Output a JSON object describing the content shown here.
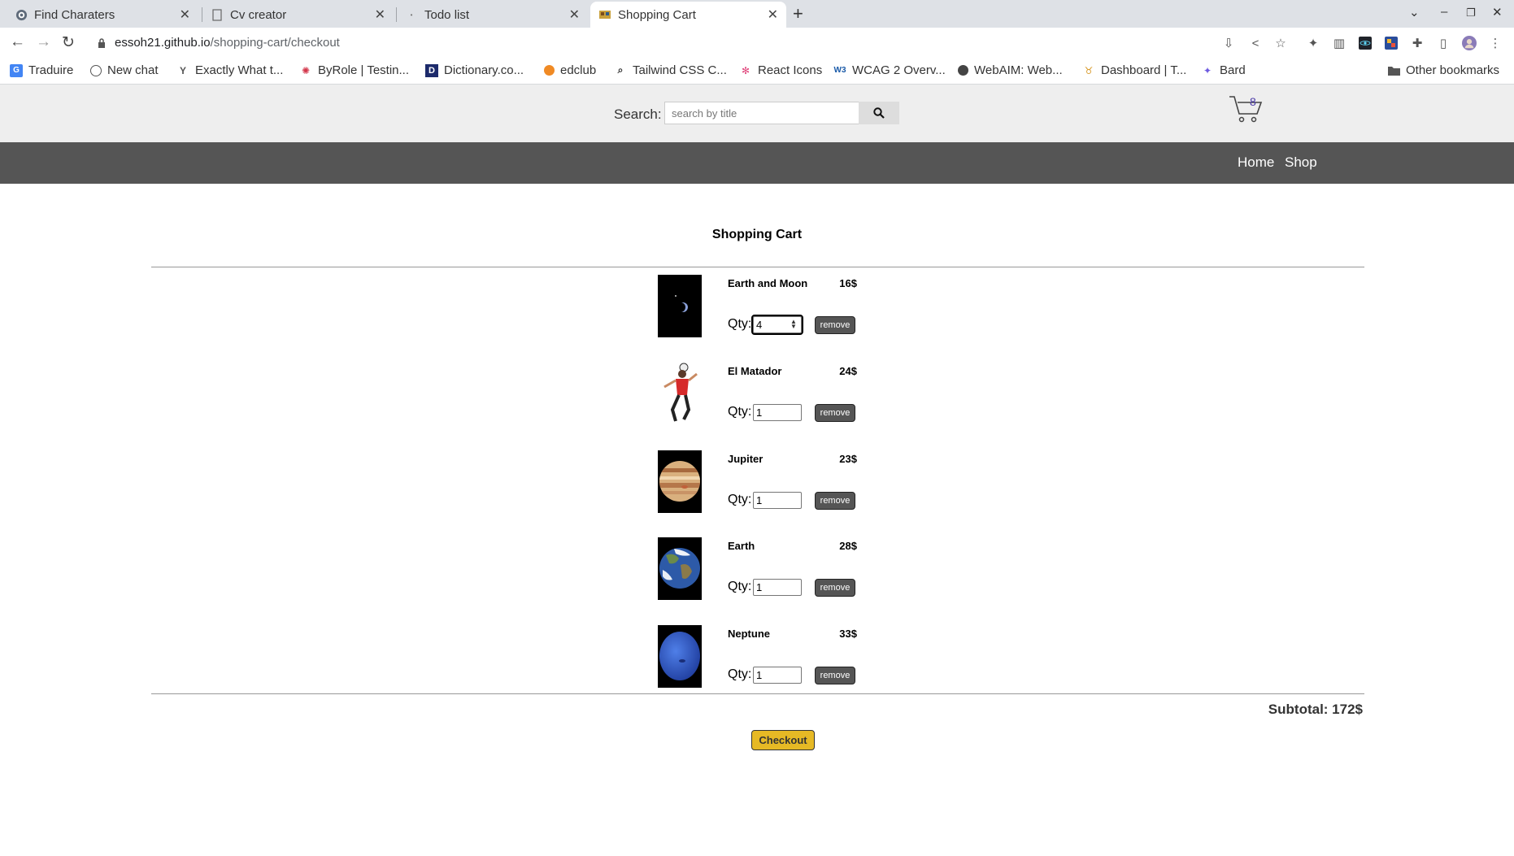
{
  "browser": {
    "tabs": [
      {
        "title": "Find Charaters",
        "icon": "globe-icon"
      },
      {
        "title": "Cv creator",
        "icon": "document-icon"
      },
      {
        "title": "Todo list",
        "icon": "dot-icon"
      },
      {
        "title": "Shopping Cart",
        "icon": "cart-favicon",
        "active": true
      }
    ],
    "url_host": "essoh21.github.io",
    "url_path": "/shopping-cart/checkout",
    "bookmarks": [
      {
        "label": "Traduire",
        "icon": "translate-icon"
      },
      {
        "label": "New chat",
        "icon": "chatgpt-icon"
      },
      {
        "label": "Exactly What t...",
        "icon": "y-icon"
      },
      {
        "label": "ByRole | Testin...",
        "icon": "octopus-icon"
      },
      {
        "label": "Dictionary.co...",
        "icon": "dictionary-icon"
      },
      {
        "label": "edclub",
        "icon": "edclub-icon"
      },
      {
        "label": "Tailwind CSS C...",
        "icon": "search-icon"
      },
      {
        "label": "React Icons",
        "icon": "react-icon"
      },
      {
        "label": "WCAG 2 Overv...",
        "icon": "w3c-icon"
      },
      {
        "label": "WebAIM: Web...",
        "icon": "webaim-icon"
      },
      {
        "label": "Dashboard | T...",
        "icon": "dashboard-icon"
      },
      {
        "label": "Bard",
        "icon": "bard-icon"
      },
      {
        "label": "Other bookmarks",
        "icon": "folder-icon"
      }
    ]
  },
  "header": {
    "search_label": "Search:",
    "search_placeholder": "search by title",
    "cart_count": "8"
  },
  "nav": {
    "home": "Home",
    "shop": "Shop"
  },
  "cart": {
    "title": "Shopping Cart",
    "qty_label": "Qty:",
    "remove_label": "remove",
    "items": [
      {
        "name": "Earth and Moon",
        "price": "16$",
        "qty": "4"
      },
      {
        "name": "El Matador",
        "price": "24$",
        "qty": "1"
      },
      {
        "name": "Jupiter",
        "price": "23$",
        "qty": "1"
      },
      {
        "name": "Earth",
        "price": "28$",
        "qty": "1"
      },
      {
        "name": "Neptune",
        "price": "33$",
        "qty": "1"
      }
    ],
    "subtotal": "Subtotal: 172$",
    "checkout_label": "Checkout"
  }
}
